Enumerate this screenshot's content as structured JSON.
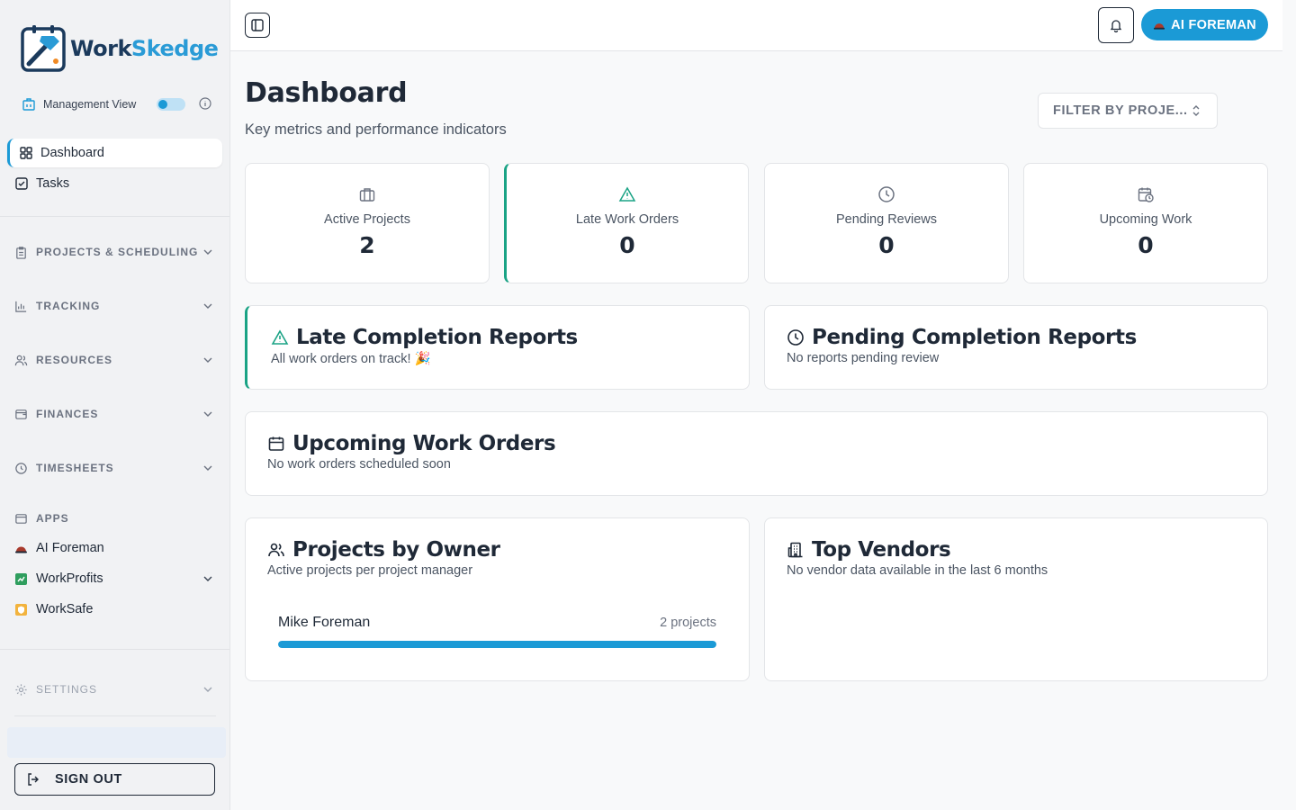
{
  "brand": {
    "name_part1": "Work",
    "name_part2": "Skedge",
    "accent": "#1b9ad6",
    "success": "#1aa385"
  },
  "management_view": {
    "label": "Management View",
    "enabled": true
  },
  "nav": {
    "dashboard": "Dashboard",
    "tasks": "Tasks"
  },
  "sections": {
    "projects_scheduling": "PROJECTS & SCHEDULING",
    "tracking": "TRACKING",
    "resources": "RESOURCES",
    "finances": "FINANCES",
    "timesheets": "TIMESHEETS",
    "apps": "APPS",
    "settings": "SETTINGS"
  },
  "apps": {
    "ai_foreman": "AI Foreman",
    "workprofits": "WorkProfits",
    "worksafe": "WorkSafe"
  },
  "sign_out": "SIGN OUT",
  "topbar": {
    "ai_foreman_button": "AI FOREMAN"
  },
  "page": {
    "title": "Dashboard",
    "subtitle": "Key metrics and performance indicators",
    "filter_label": "FILTER BY PROJE..."
  },
  "stats": [
    {
      "label": "Active Projects",
      "value": "2",
      "icon": "briefcase-icon"
    },
    {
      "label": "Late Work Orders",
      "value": "0",
      "icon": "warning-triangle-icon"
    },
    {
      "label": "Pending Reviews",
      "value": "0",
      "icon": "clock-icon"
    },
    {
      "label": "Upcoming Work",
      "value": "0",
      "icon": "calendar-clock-icon"
    }
  ],
  "panels": {
    "late": {
      "title": "Late Completion Reports",
      "subtitle": "All work orders on track! 🎉"
    },
    "pending": {
      "title": "Pending Completion Reports",
      "subtitle": "No reports pending review"
    },
    "upcoming": {
      "title": "Upcoming Work Orders",
      "subtitle": "No work orders scheduled soon"
    },
    "owners": {
      "title": "Projects by Owner",
      "subtitle": "Active projects per project manager",
      "rows": [
        {
          "name": "Mike Foreman",
          "count_label": "2 projects",
          "share": 1.0
        }
      ]
    },
    "vendors": {
      "title": "Top Vendors",
      "subtitle": "No vendor data available in the last 6 months"
    }
  }
}
